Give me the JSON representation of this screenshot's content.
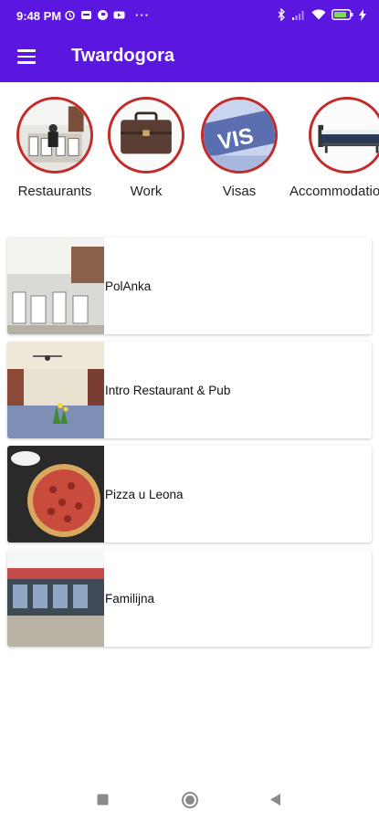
{
  "status_bar": {
    "time": "9:48 PM",
    "left_icons": [
      "alarm-icon",
      "notification-icon",
      "app-icon",
      "youtube-icon"
    ],
    "more": "···",
    "right_icons": [
      "bluetooth-icon",
      "signal-icon",
      "wifi-icon",
      "battery-icon",
      "charging-icon"
    ]
  },
  "app_bar": {
    "title": "Twardogora",
    "menu_icon": "hamburger-menu-icon",
    "background": "#5b16e0"
  },
  "categories": [
    {
      "label": "Restaurants",
      "icon": "restaurant-photo"
    },
    {
      "label": "Work",
      "icon": "briefcase-photo"
    },
    {
      "label": "Visas",
      "icon": "visa-photo"
    },
    {
      "label": "Accommodation",
      "icon": "bed-photo"
    }
  ],
  "places": [
    {
      "name": "PolAnka",
      "image": "restaurant-interior-photo"
    },
    {
      "name": "Intro Restaurant & Pub",
      "image": "pub-interior-photo"
    },
    {
      "name": "Pizza u Leona",
      "image": "pizza-photo"
    },
    {
      "name": "Familijna",
      "image": "restaurant-exterior-photo"
    }
  ],
  "nav_bar": {
    "buttons": [
      "recent-apps-icon",
      "home-icon",
      "back-icon"
    ]
  },
  "colors": {
    "accent": "#5b16e0",
    "category_ring": "#c32a2a"
  }
}
